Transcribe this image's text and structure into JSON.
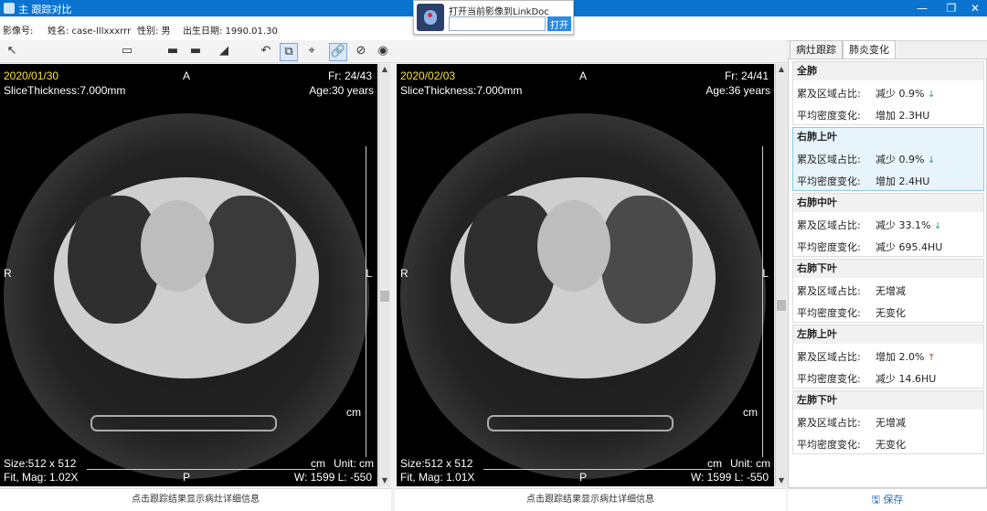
{
  "window": {
    "title": "主 跟踪对比"
  },
  "info": {
    "image_no_label": "影像号:",
    "name": "姓名: case-lllxxxrrr",
    "gender": "性别: 男",
    "dob": "出生日期: 1990.01.30"
  },
  "popup": {
    "text": "打开当前影像到LinkDoc",
    "button": "打开"
  },
  "viewers": [
    {
      "date": "2020/01/30",
      "fr": "Fr: 24/43",
      "thickness": "SliceThickness:7.000mm",
      "age": "Age:30 years",
      "top": "A",
      "left": "R",
      "right": "L",
      "bottom": "P",
      "cm1": "cm",
      "cm2": "cm",
      "unit": "Unit:  cm",
      "size": "Size:512 x 512",
      "mag": "Fit, Mag: 1.02X",
      "wl": "W: 1599 L: -550"
    },
    {
      "date": "2020/02/03",
      "fr": "Fr: 24/41",
      "thickness": "SliceThickness:7.000mm",
      "age": "Age:36 years",
      "top": "A",
      "left": "R",
      "right": "L",
      "bottom": "P",
      "cm1": "cm",
      "cm2": "cm",
      "unit": "Unit:  cm",
      "size": "Size:512 x 512",
      "mag": "Fit, Mag: 1.01X",
      "wl": "W: 1599 L: -550"
    }
  ],
  "status": {
    "left": "点击跟踪结果显示病灶详细信息",
    "right": "点击跟踪结果显示病灶详细信息"
  },
  "tabs": [
    {
      "label": "病灶跟踪"
    },
    {
      "label": "肺炎变化"
    }
  ],
  "groups": [
    {
      "title": "全肺",
      "area_label": "累及区域占比:",
      "area_value": "减少 0.9%",
      "trend": "↓",
      "density_label": "平均密度变化:",
      "density_value": "增加 2.3HU"
    },
    {
      "title": "右肺上叶",
      "area_label": "累及区域占比:",
      "area_value": "减少 0.9%",
      "trend": "↓",
      "density_label": "平均密度变化:",
      "density_value": "增加 2.4HU"
    },
    {
      "title": "右肺中叶",
      "area_label": "累及区域占比:",
      "area_value": "减少 33.1%",
      "trend": "↓",
      "density_label": "平均密度变化:",
      "density_value": "减少 695.4HU"
    },
    {
      "title": "右肺下叶",
      "area_label": "累及区域占比:",
      "area_value": "无增减",
      "trend": "",
      "density_label": "平均密度变化:",
      "density_value": "无变化"
    },
    {
      "title": "左肺上叶",
      "area_label": "累及区域占比:",
      "area_value": "增加 2.0%",
      "trend": "↑",
      "density_label": "平均密度变化:",
      "density_value": "减少 14.6HU"
    },
    {
      "title": "左肺下叶",
      "area_label": "累及区域占比:",
      "area_value": "无增减",
      "trend": "",
      "density_label": "平均密度变化:",
      "density_value": "无变化"
    }
  ],
  "save": {
    "label": "保存"
  }
}
